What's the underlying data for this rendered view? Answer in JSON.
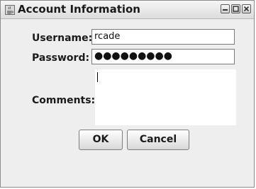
{
  "window": {
    "title": "Account Information",
    "icons": [
      "java-cup-icon",
      "minimize-icon",
      "maximize-icon",
      "close-icon"
    ]
  },
  "form": {
    "username_label": "Username:",
    "username_value": "rcade",
    "password_label": "Password:",
    "password_value": "●●●●●●●●●",
    "comments_label": "Comments:",
    "comments_value": ""
  },
  "buttons": {
    "ok_label": "OK",
    "cancel_label": "Cancel"
  }
}
